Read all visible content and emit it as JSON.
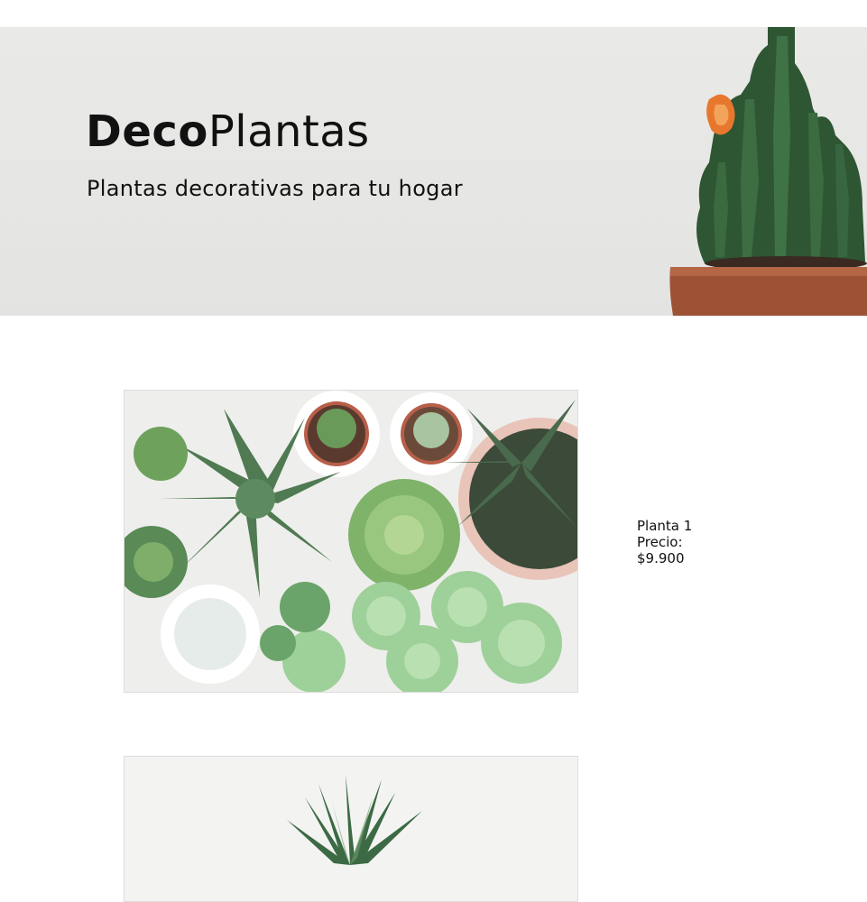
{
  "header": {
    "brand_bold": "Deco",
    "brand_light": "Plantas",
    "tagline": "Plantas decorativas para tu hogar"
  },
  "products": [
    {
      "name": "Planta 1",
      "price_label": "Precio:",
      "price": "$9.900"
    }
  ],
  "colors": {
    "hero_bg": "#e7e7e5",
    "cactus_green": "#2f5a35",
    "pot_terracotta": "#a0533a",
    "flower_orange": "#e8772e"
  }
}
